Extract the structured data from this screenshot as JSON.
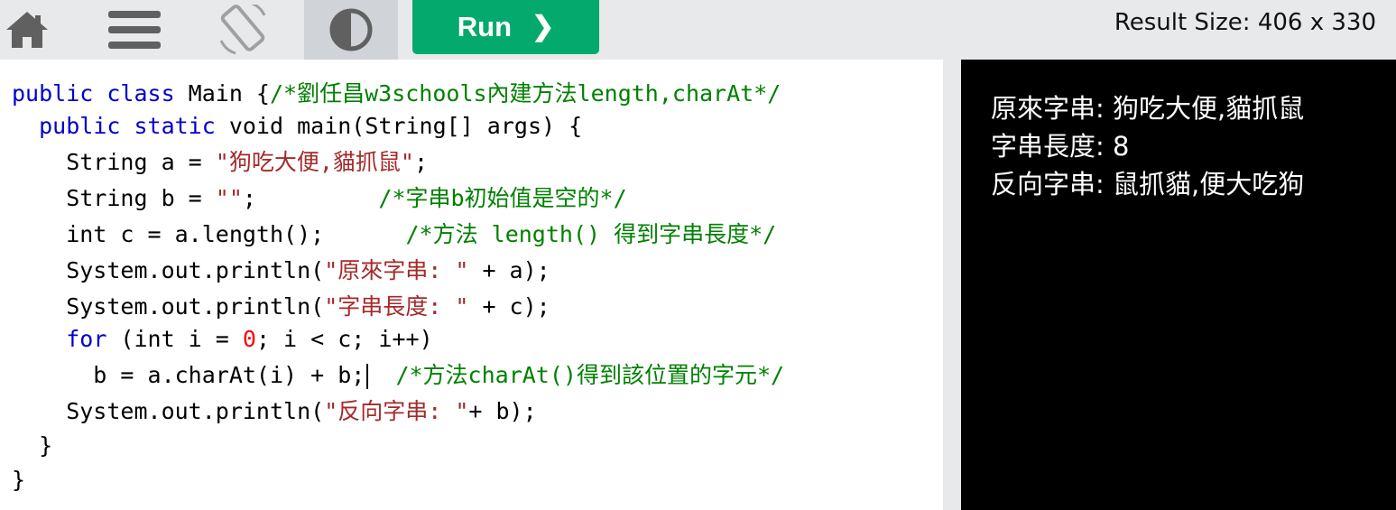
{
  "toolbar": {
    "icons": [
      "home-icon",
      "menu-icon",
      "rotate-icon",
      "contrast-icon"
    ],
    "run_label": "Run",
    "run_chevron": "❯",
    "result_size": "Result Size: 406 x 330"
  },
  "colors": {
    "run": "#04aa6d",
    "toolbar_bg": "#e7e9eb",
    "keyword": "#0000cd",
    "string": "#a52a2a",
    "comment": "#008000",
    "number": "#ff0000"
  },
  "editor": {
    "lines": [
      [
        {
          "t": "public class",
          "c": "kw"
        },
        {
          "t": " Main {"
        },
        {
          "t": "/*劉任昌w3schools內建方法length,charAt*/",
          "c": "cmt"
        }
      ],
      [
        {
          "t": "  "
        },
        {
          "t": "public static",
          "c": "kw"
        },
        {
          "t": " void main(String[] args) {"
        }
      ],
      [
        {
          "t": "    String a = "
        },
        {
          "t": "\"狗吃大便,貓抓鼠\"",
          "c": "str"
        },
        {
          "t": ";"
        }
      ],
      [
        {
          "t": "    String b = "
        },
        {
          "t": "\"\"",
          "c": "str"
        },
        {
          "t": ";         "
        },
        {
          "t": "/*字串b初始值是空的*/",
          "c": "cmt"
        }
      ],
      [
        {
          "t": "    int c = a.length();      "
        },
        {
          "t": "/*方法 length() 得到字串長度*/",
          "c": "cmt"
        }
      ],
      [
        {
          "t": "    System.out.println("
        },
        {
          "t": "\"原來字串: \"",
          "c": "str"
        },
        {
          "t": " + a);"
        }
      ],
      [
        {
          "t": "    System.out.println("
        },
        {
          "t": "\"字串長度: \"",
          "c": "str"
        },
        {
          "t": " + c);"
        }
      ],
      [
        {
          "t": "    "
        },
        {
          "t": "for",
          "c": "kw"
        },
        {
          "t": " (int i = "
        },
        {
          "t": "0",
          "c": "num"
        },
        {
          "t": "; i < c; i++)"
        }
      ],
      [
        {
          "t": "      b = a.charAt(i) + b;"
        },
        {
          "caret": true
        },
        {
          "t": "  "
        },
        {
          "t": "/*方法charAt()得到該位置的字元*/",
          "c": "cmt"
        }
      ],
      [
        {
          "t": "    System.out.println("
        },
        {
          "t": "\"反向字串: \"",
          "c": "str"
        },
        {
          "t": "+ b);"
        }
      ],
      [
        {
          "t": "  }"
        }
      ],
      [
        {
          "t": "}"
        }
      ]
    ]
  },
  "result": {
    "lines": [
      "原來字串: 狗吃大便,貓抓鼠",
      "字串長度: 8",
      "反向字串: 鼠抓貓,便大吃狗"
    ]
  }
}
